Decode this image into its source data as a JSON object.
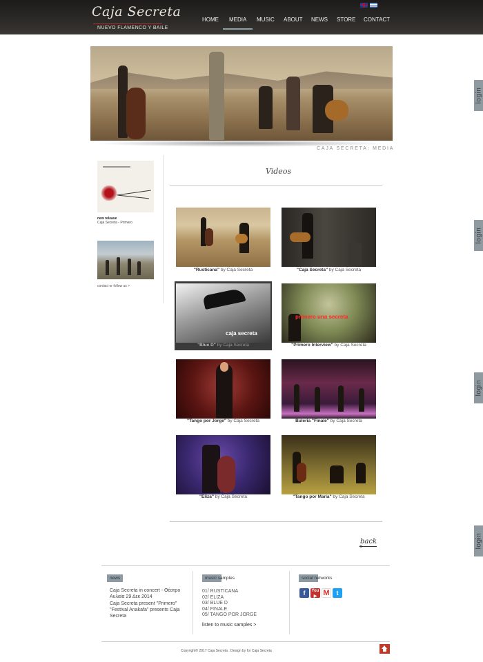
{
  "brand": {
    "name": "Caja Secreta",
    "tagline": "NUEVO FLAMENCO Y BAILE"
  },
  "languages": [
    "en-flag-icon",
    "gr-flag-icon"
  ],
  "nav": [
    {
      "label": "HOME"
    },
    {
      "label": "MEDIA",
      "active": true
    },
    {
      "label": "MUSIC"
    },
    {
      "label": "ABOUT"
    },
    {
      "label": "NEWS"
    },
    {
      "label": "STORE"
    },
    {
      "label": "CONTACT"
    }
  ],
  "hero": {
    "caption": "CAJA SECRETA: MEDIA"
  },
  "sidebar": {
    "new_release_label": "new release",
    "new_release_title": "Caja Secreta - Primero",
    "contact_link": "contact or follow us >"
  },
  "videos": {
    "title": "Videos",
    "items": [
      {
        "title": "\"Rusticana\"",
        "by": " by Caja Secreta"
      },
      {
        "title": "\"Caja Secreta\"",
        "by": " by Caja Secreta"
      },
      {
        "title": "\"Blue D\"",
        "by": " by Caja Secreta",
        "overlay": "caja secreta"
      },
      {
        "title": "\"Primero Interview\"",
        "by": " by Caja Secreta",
        "overlay": "primero  una  secreta"
      },
      {
        "title": "\"Tango por Jorge\"",
        "by": " by Caja Secreta"
      },
      {
        "title": "Buleria \"Finale\"",
        "by": " by Caja Secreta"
      },
      {
        "title": "\"Eliza\"",
        "by": " by Caja Secreta"
      },
      {
        "title": "\"Tango por Maria\"",
        "by": " by Caja Secreta"
      }
    ],
    "back_label": "back"
  },
  "login_label": "login",
  "footer": {
    "news": {
      "heading": "news",
      "items": [
        "Caja Secreta in concert - Θέατρο Αυλαία 29 Δεκ 2014",
        "Caja Secreta present \"Primero\"",
        "\"Festival Anakafa\" presents Caja Secreta"
      ]
    },
    "samples": {
      "heading": "music samples",
      "items": [
        "01/ RUSTICANA",
        "02/ ELIZA",
        "03/ BLUE D",
        "04/ FINALE",
        "05/ TANGO POR JORGE"
      ],
      "listen_link": "listen to music samples >"
    },
    "social": {
      "heading": "social networks",
      "icons": [
        "facebook-icon",
        "youtube-icon",
        "gmail-icon",
        "twitter-icon"
      ]
    },
    "copyright": "Copyright© 2017 Caja Secreta . Design by  for Caja Secreta"
  }
}
